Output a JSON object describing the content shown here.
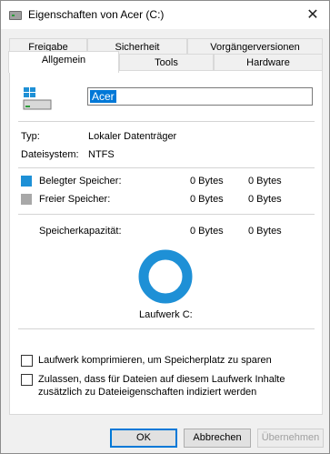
{
  "window": {
    "title": "Eigenschaften von Acer (C:)"
  },
  "tabs": {
    "row1": [
      {
        "label": "Freigabe"
      },
      {
        "label": "Sicherheit"
      },
      {
        "label": "Vorgängerversionen"
      }
    ],
    "row2": [
      {
        "label": "Allgemein",
        "active": true
      },
      {
        "label": "Tools"
      },
      {
        "label": "Hardware"
      }
    ]
  },
  "general": {
    "drive_name": "Acer",
    "type_label": "Typ:",
    "type_value": "Lokaler Datenträger",
    "fs_label": "Dateisystem:",
    "fs_value": "NTFS",
    "used_label": "Belegter Speicher:",
    "used_bytes": "0 Bytes",
    "used_size": "0 Bytes",
    "free_label": "Freier Speicher:",
    "free_bytes": "0 Bytes",
    "free_size": "0 Bytes",
    "capacity_label": "Speicherkapazität:",
    "capacity_bytes": "0 Bytes",
    "capacity_size": "0 Bytes",
    "drive_caption": "Laufwerk C:",
    "used_color": "#1e90d6",
    "free_color": "#a8a8a8"
  },
  "options": {
    "compress_label": "Laufwerk komprimieren, um Speicherplatz zu sparen",
    "index_label_line1": "Zulassen, dass für Dateien auf diesem Laufwerk Inhalte",
    "index_label_line2": "zusätzlich zu Dateieigenschaften indiziert werden"
  },
  "buttons": {
    "ok": "OK",
    "cancel": "Abbrechen",
    "apply": "Übernehmen"
  }
}
